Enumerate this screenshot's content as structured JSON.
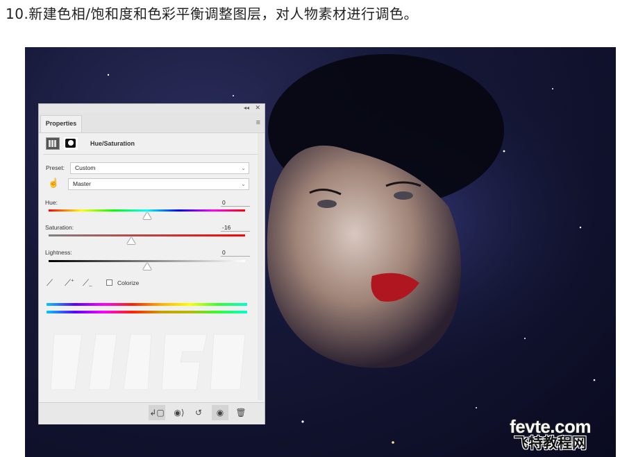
{
  "heading": "10.新建色相/饱和度和色彩平衡调整图层，对人物素材进行调色。",
  "watermark": {
    "line1": "fevte.com",
    "line2": "飞特教程网"
  },
  "panel": {
    "tab": "Properties",
    "title": "Hue/Saturation",
    "preset_label": "Preset:",
    "preset_value": "Custom",
    "channel_value": "Master",
    "sliders": [
      {
        "label": "Hue:",
        "value": "0",
        "fraction": 0.5
      },
      {
        "label": "Saturation:",
        "value": "-16",
        "fraction": 0.42
      },
      {
        "label": "Lightness:",
        "value": "0",
        "fraction": 0.5
      }
    ],
    "colorize_label": "Colorize",
    "colorize_checked": false
  },
  "icons": {
    "collapse": "double-chevron-left",
    "close": "close",
    "menu": "panel-menu",
    "adjustment": "hue-saturation-adjustment",
    "mask": "layer-mask",
    "targeted": "targeted-adjustment-hand",
    "eyedropper": "eyedropper",
    "eyedropper_add": "eyedropper-add",
    "eyedropper_subtract": "eyedropper-subtract",
    "clip": "clip-to-layer",
    "view_previous": "view-previous-state",
    "reset": "reset",
    "visibility": "toggle-visibility",
    "delete": "delete-trash"
  }
}
